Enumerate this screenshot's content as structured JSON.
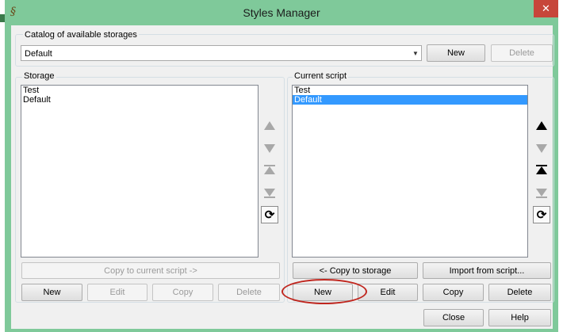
{
  "window": {
    "title": "Styles Manager",
    "app_icon": "script-s-icon",
    "close_glyph": "✕"
  },
  "catalog": {
    "label": "Catalog of available storages",
    "selected": "Default",
    "new_label": "New",
    "delete_label": "Delete"
  },
  "storage": {
    "label": "Storage",
    "items": [
      "Test",
      "Default"
    ],
    "copy_to_script_label": "Copy to current script ->",
    "new_label": "New",
    "edit_label": "Edit",
    "copy_label": "Copy",
    "delete_label": "Delete"
  },
  "current_script": {
    "label": "Current script",
    "items": [
      "Test",
      "Default"
    ],
    "selected_index": 1,
    "copy_to_storage_label": "<- Copy to storage",
    "import_label": "Import from script...",
    "new_label": "New",
    "edit_label": "Edit",
    "copy_label": "Copy",
    "delete_label": "Delete"
  },
  "footer": {
    "close_label": "Close",
    "help_label": "Help"
  },
  "colors": {
    "titlebar": "#7fc99a",
    "selection": "#3399ff",
    "annotation_ring": "#c0261e"
  }
}
